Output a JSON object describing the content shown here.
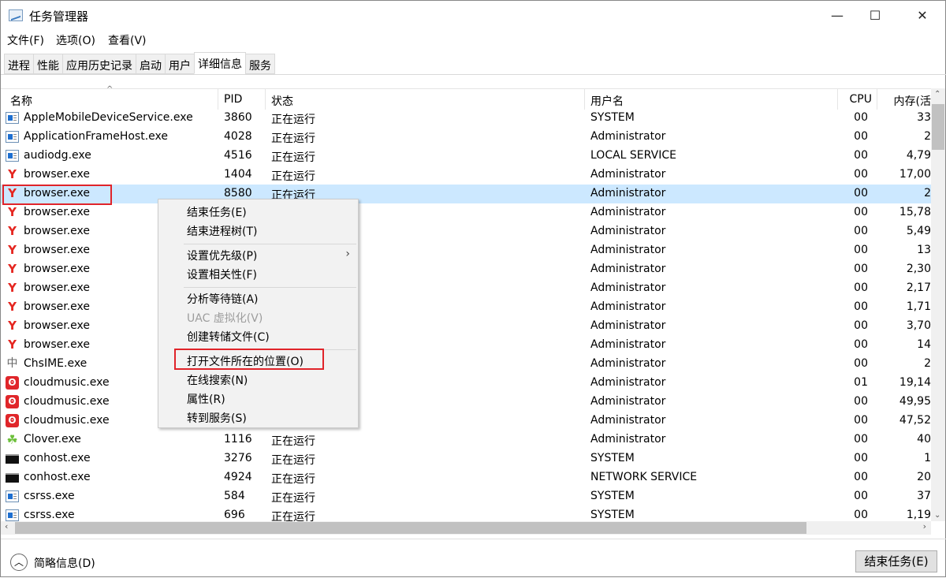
{
  "window": {
    "title": "任务管理器",
    "minimize": "—",
    "maximize": "☐",
    "close": "✕"
  },
  "menu": [
    "文件(F)",
    "选项(O)",
    "查看(V)"
  ],
  "tabs": [
    {
      "label": "进程"
    },
    {
      "label": "性能"
    },
    {
      "label": "应用历史记录"
    },
    {
      "label": "启动"
    },
    {
      "label": "用户"
    },
    {
      "label": "详细信息",
      "active": true
    },
    {
      "label": "服务"
    }
  ],
  "columns": {
    "name": "名称",
    "pid": "PID",
    "status": "状态",
    "user": "用户名",
    "cpu": "CPU",
    "mem": "内存(活"
  },
  "rows": [
    {
      "name": "AppleMobileDeviceService.exe",
      "icon": "service",
      "pid": "3860",
      "status": "正在运行",
      "user": "SYSTEM",
      "cpu": "00",
      "mem": "33"
    },
    {
      "name": "ApplicationFrameHost.exe",
      "icon": "service",
      "pid": "4028",
      "status": "正在运行",
      "user": "Administrator",
      "cpu": "00",
      "mem": "2"
    },
    {
      "name": "audiodg.exe",
      "icon": "service",
      "pid": "4516",
      "status": "正在运行",
      "user": "LOCAL SERVICE",
      "cpu": "00",
      "mem": "4,79"
    },
    {
      "name": "browser.exe",
      "icon": "yandex",
      "pid": "1404",
      "status": "正在运行",
      "user": "Administrator",
      "cpu": "00",
      "mem": "17,00"
    },
    {
      "name": "browser.exe",
      "icon": "yandex",
      "pid": "8580",
      "status": "正在运行",
      "user": "Administrator",
      "cpu": "00",
      "mem": "2",
      "selected": true
    },
    {
      "name": "browser.exe",
      "icon": "yandex",
      "pid": "",
      "status": "",
      "user": "Administrator",
      "cpu": "00",
      "mem": "15,78"
    },
    {
      "name": "browser.exe",
      "icon": "yandex",
      "pid": "",
      "status": "",
      "user": "Administrator",
      "cpu": "00",
      "mem": "5,49"
    },
    {
      "name": "browser.exe",
      "icon": "yandex",
      "pid": "",
      "status": "",
      "user": "Administrator",
      "cpu": "00",
      "mem": "13"
    },
    {
      "name": "browser.exe",
      "icon": "yandex",
      "pid": "",
      "status": "",
      "user": "Administrator",
      "cpu": "00",
      "mem": "2,30"
    },
    {
      "name": "browser.exe",
      "icon": "yandex",
      "pid": "",
      "status": "",
      "user": "Administrator",
      "cpu": "00",
      "mem": "2,17"
    },
    {
      "name": "browser.exe",
      "icon": "yandex",
      "pid": "",
      "status": "",
      "user": "Administrator",
      "cpu": "00",
      "mem": "1,71"
    },
    {
      "name": "browser.exe",
      "icon": "yandex",
      "pid": "",
      "status": "",
      "user": "Administrator",
      "cpu": "00",
      "mem": "3,70"
    },
    {
      "name": "browser.exe",
      "icon": "yandex",
      "pid": "",
      "status": "",
      "user": "Administrator",
      "cpu": "00",
      "mem": "14"
    },
    {
      "name": "ChsIME.exe",
      "icon": "ime",
      "pid": "",
      "status": "",
      "user": "Administrator",
      "cpu": "00",
      "mem": "2"
    },
    {
      "name": "cloudmusic.exe",
      "icon": "cloudmusic",
      "pid": "",
      "status": "",
      "user": "Administrator",
      "cpu": "01",
      "mem": "19,14"
    },
    {
      "name": "cloudmusic.exe",
      "icon": "cloudmusic",
      "pid": "",
      "status": "",
      "user": "Administrator",
      "cpu": "00",
      "mem": "49,95"
    },
    {
      "name": "cloudmusic.exe",
      "icon": "cloudmusic",
      "pid": "",
      "status": "",
      "user": "Administrator",
      "cpu": "00",
      "mem": "47,52"
    },
    {
      "name": "Clover.exe",
      "icon": "clover",
      "pid": "1116",
      "status": "正在运行",
      "user": "Administrator",
      "cpu": "00",
      "mem": "40"
    },
    {
      "name": "conhost.exe",
      "icon": "console",
      "pid": "3276",
      "status": "正在运行",
      "user": "SYSTEM",
      "cpu": "00",
      "mem": "1"
    },
    {
      "name": "conhost.exe",
      "icon": "console",
      "pid": "4924",
      "status": "正在运行",
      "user": "NETWORK SERVICE",
      "cpu": "00",
      "mem": "20"
    },
    {
      "name": "csrss.exe",
      "icon": "service",
      "pid": "584",
      "status": "正在运行",
      "user": "SYSTEM",
      "cpu": "00",
      "mem": "37"
    },
    {
      "name": "csrss.exe",
      "icon": "service",
      "pid": "696",
      "status": "正在运行",
      "user": "SYSTEM",
      "cpu": "00",
      "mem": "1,19"
    }
  ],
  "context_menu": [
    {
      "label": "结束任务(E)"
    },
    {
      "label": "结束进程树(T)"
    },
    {
      "sep": true
    },
    {
      "label": "设置优先级(P)",
      "submenu": true
    },
    {
      "label": "设置相关性(F)"
    },
    {
      "sep": true
    },
    {
      "label": "分析等待链(A)"
    },
    {
      "label": "UAC 虚拟化(V)",
      "disabled": true
    },
    {
      "label": "创建转储文件(C)"
    },
    {
      "sep": true
    },
    {
      "label": "打开文件所在的位置(O)",
      "highlighted": true
    },
    {
      "label": "在线搜索(N)"
    },
    {
      "label": "属性(R)"
    },
    {
      "label": "转到服务(S)"
    }
  ],
  "footer": {
    "brief": "简略信息(D)",
    "end_task": "结束任务(E)"
  },
  "colors": {
    "selection": "#cce8ff",
    "highlight_box": "#e0242a"
  }
}
